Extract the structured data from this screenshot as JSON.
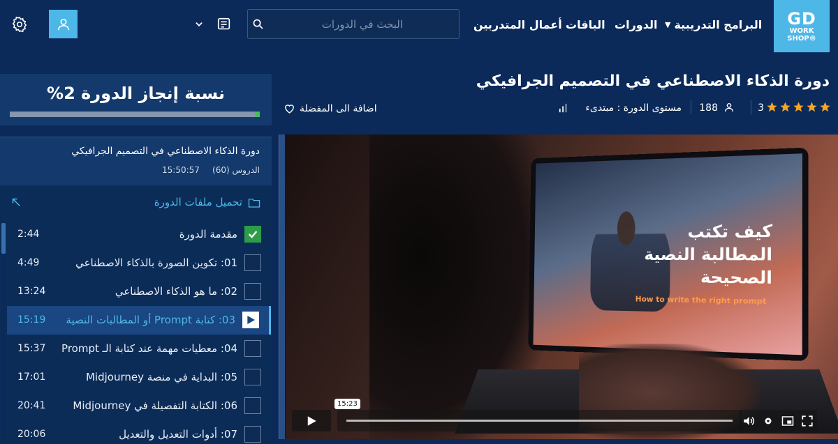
{
  "header": {
    "logo": {
      "line1": "GD",
      "line2": "WORK",
      "line3": "SHOP®"
    },
    "nav": {
      "programs": "البرامج التدريبية",
      "courses": "الدورات",
      "packages": "الباقات",
      "works": "أعمال المتدربين"
    },
    "search": {
      "placeholder": "البحث في الدورات"
    }
  },
  "progress": {
    "title": "نسبة إنجاز الدورة 2%",
    "percent": 2
  },
  "sidebar": {
    "course_title": "دورة الذكاء الاصطناعي في التصميم الجرافيكي",
    "lessons_label": "الدروس (60)",
    "duration": "15:50:57",
    "download_label": "تحميل ملفات الدورة",
    "lessons": [
      {
        "name": "مقدمة الدورة",
        "time": "2:44",
        "state": "done"
      },
      {
        "name": "01: تكوين الصورة بالذكاء الاصطناعي",
        "time": "4:49",
        "state": "pending"
      },
      {
        "name": "02: ما هو الذكاء الاصطناعي",
        "time": "13:24",
        "state": "pending"
      },
      {
        "name": "03: كتابة Prompt أو المطالبات النصية",
        "time": "15:19",
        "state": "active"
      },
      {
        "name": "04: معطيات مهمة عند كتابة الـ Prompt",
        "time": "15:37",
        "state": "pending"
      },
      {
        "name": "05: البداية في منصة Midjourney",
        "time": "17:01",
        "state": "pending"
      },
      {
        "name": "06: الكتابة التفصيلة في Midjourney",
        "time": "20:41",
        "state": "pending"
      },
      {
        "name": "07: أدوات التعديل والتعديل",
        "time": "20:06",
        "state": "pending"
      }
    ]
  },
  "course": {
    "title": "دورة الذكاء الاصطناعي في التصميم الجرافيكي",
    "rating": "3",
    "stars": 5,
    "students": "188",
    "level": "مستوى الدورة : مبتدىء",
    "favorite": "اضافة الى المفضلة"
  },
  "video": {
    "overlay_ar_1": "كيف تكتب",
    "overlay_ar_2": "المطالبة النصية",
    "overlay_ar_3": "الصحيحة",
    "overlay_en": "How to write the right prompt",
    "tooltip_time": "15:23"
  },
  "colors": {
    "accent": "#4db8e8",
    "bg": "#0b2a5a",
    "panel": "#13396d",
    "done": "#2d9d4a",
    "star": "#f5a623"
  }
}
